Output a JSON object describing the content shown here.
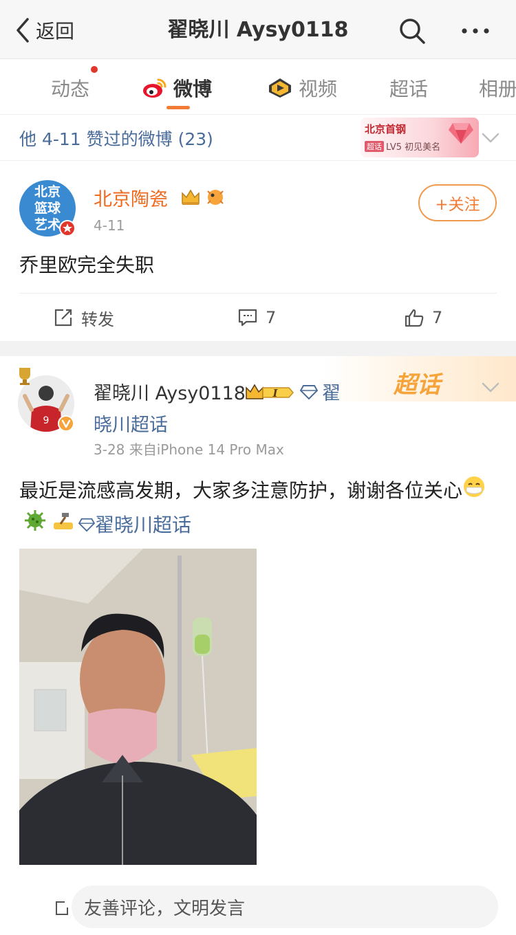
{
  "nav": {
    "back_label": "返回",
    "title": "翟晓川 Aysy0118"
  },
  "tabs": [
    {
      "label": "动态",
      "has_dot": true
    },
    {
      "label": "微博",
      "active": true
    },
    {
      "label": "视频"
    },
    {
      "label": "超话"
    },
    {
      "label": "相册"
    }
  ],
  "likes_header": {
    "text": "他 4-11 赞过的微博 (23)",
    "badge_team": "北京首钢",
    "badge_tag": "超话",
    "badge_level": "LV5 初见美名"
  },
  "post1": {
    "avatar_text": [
      "北京",
      "篮球",
      "艺术"
    ],
    "author": "北京陶瓷",
    "date": "4-11",
    "follow_label": "+关注",
    "content": "乔里欧完全失职",
    "repost_label": "转发",
    "comment_count": "7",
    "like_count": "7"
  },
  "post2": {
    "author": "翟晓川 Aysy0118",
    "level_badge": "I",
    "topic_char": "翟",
    "topic_rest": "晓川超话",
    "date_source": "3-28  来自iPhone 14 Pro Max",
    "content": "最近是流感高发期，大家多注意防护，谢谢各位关心",
    "content_topic": "翟晓川超话",
    "supertopic_mark": "超话",
    "avatar_jersey": "9"
  },
  "comment_bar": {
    "placeholder": "友善评论，文明发言"
  },
  "colors": {
    "link": "#4a6c9b",
    "accent": "#f27b35",
    "orange_name": "#f06a1e"
  }
}
